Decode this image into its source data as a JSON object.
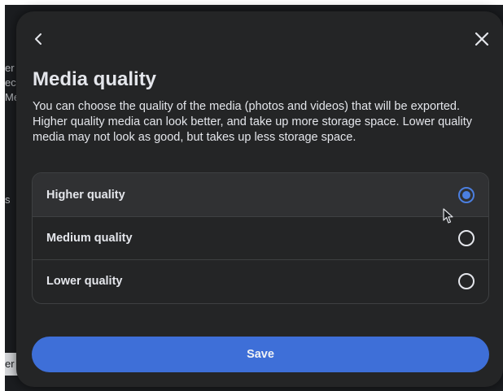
{
  "background": {
    "fragments": [
      "er",
      "ec",
      "Me",
      "s"
    ],
    "bottom_fragment": "er"
  },
  "dialog": {
    "back_icon": "chevron-left-icon",
    "close_icon": "close-icon",
    "title": "Media quality",
    "description": "You can choose the quality of the media (photos and videos) that will be exported. Higher quality media can look better, and take up more storage space. Lower quality media may not look as good, but takes up less storage space.",
    "options": [
      {
        "label": "Higher quality",
        "selected": true
      },
      {
        "label": "Medium quality",
        "selected": false
      },
      {
        "label": "Lower quality",
        "selected": false
      }
    ],
    "save_label": "Save"
  },
  "colors": {
    "modal_bg": "#242526",
    "accent": "#3e6fd8",
    "radio_selected": "#4b7fe0",
    "text": "#e4e6eb"
  }
}
